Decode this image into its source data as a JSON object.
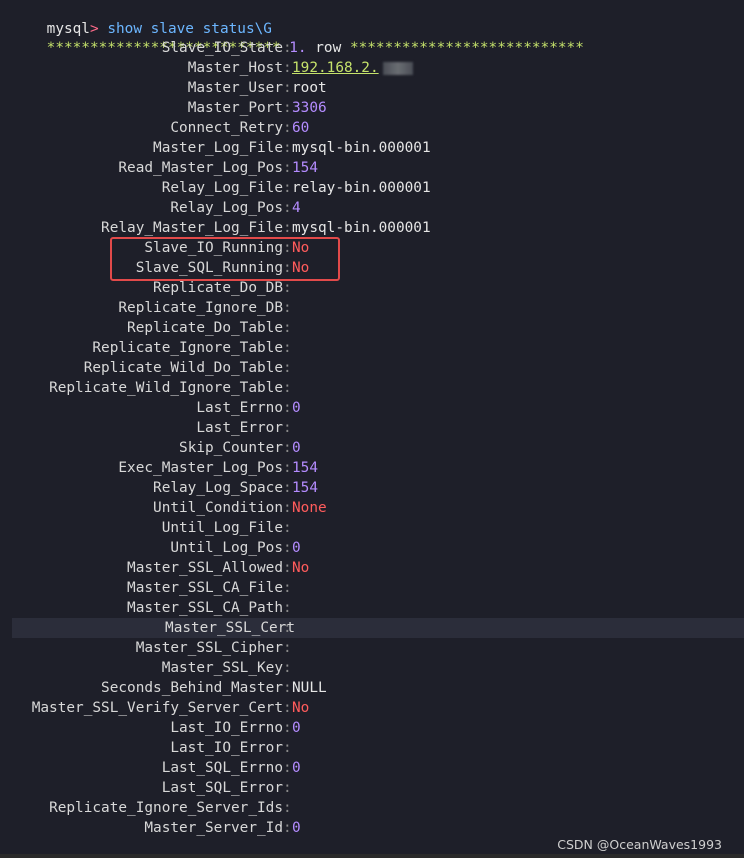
{
  "prompt": {
    "name": "mysql",
    "arrow": ">",
    "command": "show slave status\\G"
  },
  "row_header": {
    "left_stars": "***************************",
    "number": "1.",
    "label": "row",
    "right_stars": "***************************"
  },
  "fields": [
    {
      "name": "Slave_IO_State",
      "value": "",
      "color": "normal"
    },
    {
      "name": "Master_Host",
      "value": "192.168.2.",
      "color": "yellow-underline",
      "masked": true
    },
    {
      "name": "Master_User",
      "value": "root",
      "color": "normal"
    },
    {
      "name": "Master_Port",
      "value": "3306",
      "color": "purple"
    },
    {
      "name": "Connect_Retry",
      "value": "60",
      "color": "purple"
    },
    {
      "name": "Master_Log_File",
      "value": "mysql-bin.000001",
      "color": "normal"
    },
    {
      "name": "Read_Master_Log_Pos",
      "value": "154",
      "color": "purple"
    },
    {
      "name": "Relay_Log_File",
      "value": "relay-bin.000001",
      "color": "normal"
    },
    {
      "name": "Relay_Log_Pos",
      "value": "4",
      "color": "purple"
    },
    {
      "name": "Relay_Master_Log_File",
      "value": "mysql-bin.000001",
      "color": "normal"
    },
    {
      "name": "Slave_IO_Running",
      "value": "No",
      "color": "red"
    },
    {
      "name": "Slave_SQL_Running",
      "value": "No",
      "color": "red"
    },
    {
      "name": "Replicate_Do_DB",
      "value": "",
      "color": "normal"
    },
    {
      "name": "Replicate_Ignore_DB",
      "value": "",
      "color": "normal"
    },
    {
      "name": "Replicate_Do_Table",
      "value": "",
      "color": "normal"
    },
    {
      "name": "Replicate_Ignore_Table",
      "value": "",
      "color": "normal"
    },
    {
      "name": "Replicate_Wild_Do_Table",
      "value": "",
      "color": "normal"
    },
    {
      "name": "Replicate_Wild_Ignore_Table",
      "value": "",
      "color": "normal"
    },
    {
      "name": "Last_Errno",
      "value": "0",
      "color": "purple"
    },
    {
      "name": "Last_Error",
      "value": "",
      "color": "normal"
    },
    {
      "name": "Skip_Counter",
      "value": "0",
      "color": "purple"
    },
    {
      "name": "Exec_Master_Log_Pos",
      "value": "154",
      "color": "purple"
    },
    {
      "name": "Relay_Log_Space",
      "value": "154",
      "color": "purple"
    },
    {
      "name": "Until_Condition",
      "value": "None",
      "color": "red"
    },
    {
      "name": "Until_Log_File",
      "value": "",
      "color": "normal"
    },
    {
      "name": "Until_Log_Pos",
      "value": "0",
      "color": "purple"
    },
    {
      "name": "Master_SSL_Allowed",
      "value": "No",
      "color": "red"
    },
    {
      "name": "Master_SSL_CA_File",
      "value": "",
      "color": "normal"
    },
    {
      "name": "Master_SSL_CA_Path",
      "value": "",
      "color": "normal"
    },
    {
      "name": "Master_SSL_Cert",
      "value": "",
      "color": "normal",
      "highlighted": true
    },
    {
      "name": "Master_SSL_Cipher",
      "value": "",
      "color": "normal"
    },
    {
      "name": "Master_SSL_Key",
      "value": "",
      "color": "normal"
    },
    {
      "name": "Seconds_Behind_Master",
      "value": "NULL",
      "color": "normal"
    },
    {
      "name": "Master_SSL_Verify_Server_Cert",
      "value": "No",
      "color": "red"
    },
    {
      "name": "Last_IO_Errno",
      "value": "0",
      "color": "purple"
    },
    {
      "name": "Last_IO_Error",
      "value": "",
      "color": "normal"
    },
    {
      "name": "Last_SQL_Errno",
      "value": "0",
      "color": "purple"
    },
    {
      "name": "Last_SQL_Error",
      "value": "",
      "color": "normal"
    },
    {
      "name": "Replicate_Ignore_Server_Ids",
      "value": "",
      "color": "normal"
    },
    {
      "name": "Master_Server_Id",
      "value": "0",
      "color": "purple"
    }
  ],
  "watermark": "CSDN @OceanWaves1993",
  "colors": {
    "background": "#1e1f29",
    "highlight_row": "#2b2d3a",
    "annotation_box": "#e24a4a",
    "value_red": "#ff5c5c",
    "value_purple": "#b48cff",
    "prompt_pink": "#ff6b8a",
    "command_blue": "#6cb6ff",
    "stars_yellow": "#c5e26b"
  }
}
